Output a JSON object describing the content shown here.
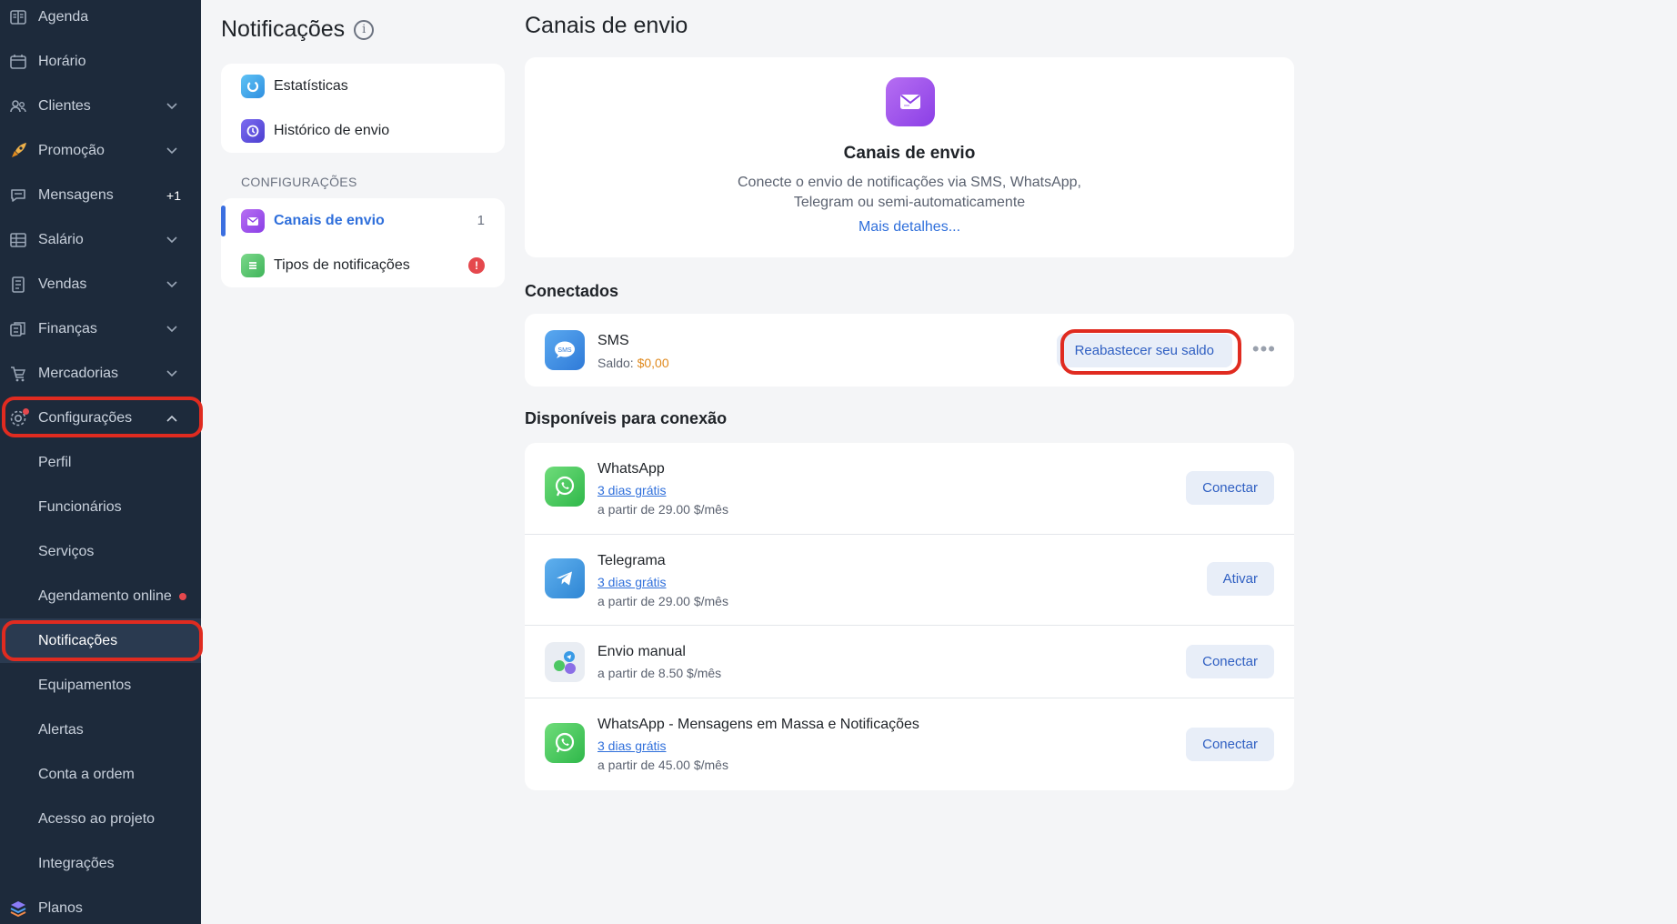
{
  "sidebar": {
    "items": [
      {
        "label": "Agenda",
        "icon": "book-icon"
      },
      {
        "label": "Horário",
        "icon": "calendar-icon"
      },
      {
        "label": "Clientes",
        "icon": "users-icon"
      },
      {
        "label": "Promoção",
        "icon": "rocket-icon"
      },
      {
        "label": "Mensagens",
        "icon": "chat-icon",
        "badge": "+1"
      },
      {
        "label": "Salário",
        "icon": "table-icon"
      },
      {
        "label": "Vendas",
        "icon": "receipt-icon"
      },
      {
        "label": "Finanças",
        "icon": "coins-icon"
      },
      {
        "label": "Mercadorias",
        "icon": "cart-icon"
      },
      {
        "label": "Configurações",
        "icon": "gear-icon"
      }
    ],
    "sub_items": [
      {
        "label": "Perfil"
      },
      {
        "label": "Funcionários"
      },
      {
        "label": "Serviços"
      },
      {
        "label": "Agendamento online"
      },
      {
        "label": "Notificações"
      },
      {
        "label": "Equipamentos"
      },
      {
        "label": "Alertas"
      },
      {
        "label": "Conta a ordem"
      },
      {
        "label": "Acesso ao projeto"
      },
      {
        "label": "Integrações"
      }
    ],
    "bottom_item": {
      "label": "Planos",
      "icon": "layers-icon"
    }
  },
  "middle": {
    "title": "Notificações",
    "info_icon": "i",
    "top_items": [
      {
        "label": "Estatísticas",
        "icon": "stats-icon"
      },
      {
        "label": "Histórico de envio",
        "icon": "history-icon"
      }
    ],
    "section_caption": "CONFIGURAÇÕES",
    "config_items": [
      {
        "label": "Canais de envio",
        "count": "1",
        "icon": "envelope-icon"
      },
      {
        "label": "Tipos de notificações",
        "alert": "!",
        "icon": "list-icon"
      }
    ]
  },
  "main": {
    "title": "Canais de envio",
    "hero": {
      "title": "Canais de envio",
      "description_line1": "Conecte o envio de notificações via SMS, WhatsApp,",
      "description_line2": "Telegram ou semi-automaticamente",
      "link": "Mais detalhes..."
    },
    "connected_heading": "Conectados",
    "connected": {
      "name": "SMS",
      "icon_text": "SMS",
      "balance_label": "Saldo:",
      "balance_value": "$0,00",
      "button": "Reabastecer seu saldo",
      "more": "•••"
    },
    "available_heading": "Disponíveis para conexão",
    "available": [
      {
        "name": "WhatsApp",
        "trial": "3 dias grátis",
        "price": "a partir de 29.00 $/mês",
        "button": "Conectar",
        "icon": "whatsapp-icon"
      },
      {
        "name": "Telegrama",
        "trial": "3 dias grátis",
        "price": "a partir de 29.00 $/mês",
        "button": "Ativar",
        "icon": "telegram-icon"
      },
      {
        "name": "Envio manual",
        "price": "a partir de 8.50 $/mês",
        "button": "Conectar",
        "icon": "multi-messenger-icon"
      },
      {
        "name": "WhatsApp - Mensagens em Massa e Notificações",
        "trial": "3 dias grátis",
        "price": "a partir de 45.00 $/mês",
        "button": "Conectar",
        "icon": "whatsapp-icon"
      }
    ]
  },
  "colors": {
    "sidebar_bg": "#1d2a3b",
    "accent": "#2f6fdb",
    "highlight_ring": "#e02b20",
    "balance": "#e08a1e"
  }
}
